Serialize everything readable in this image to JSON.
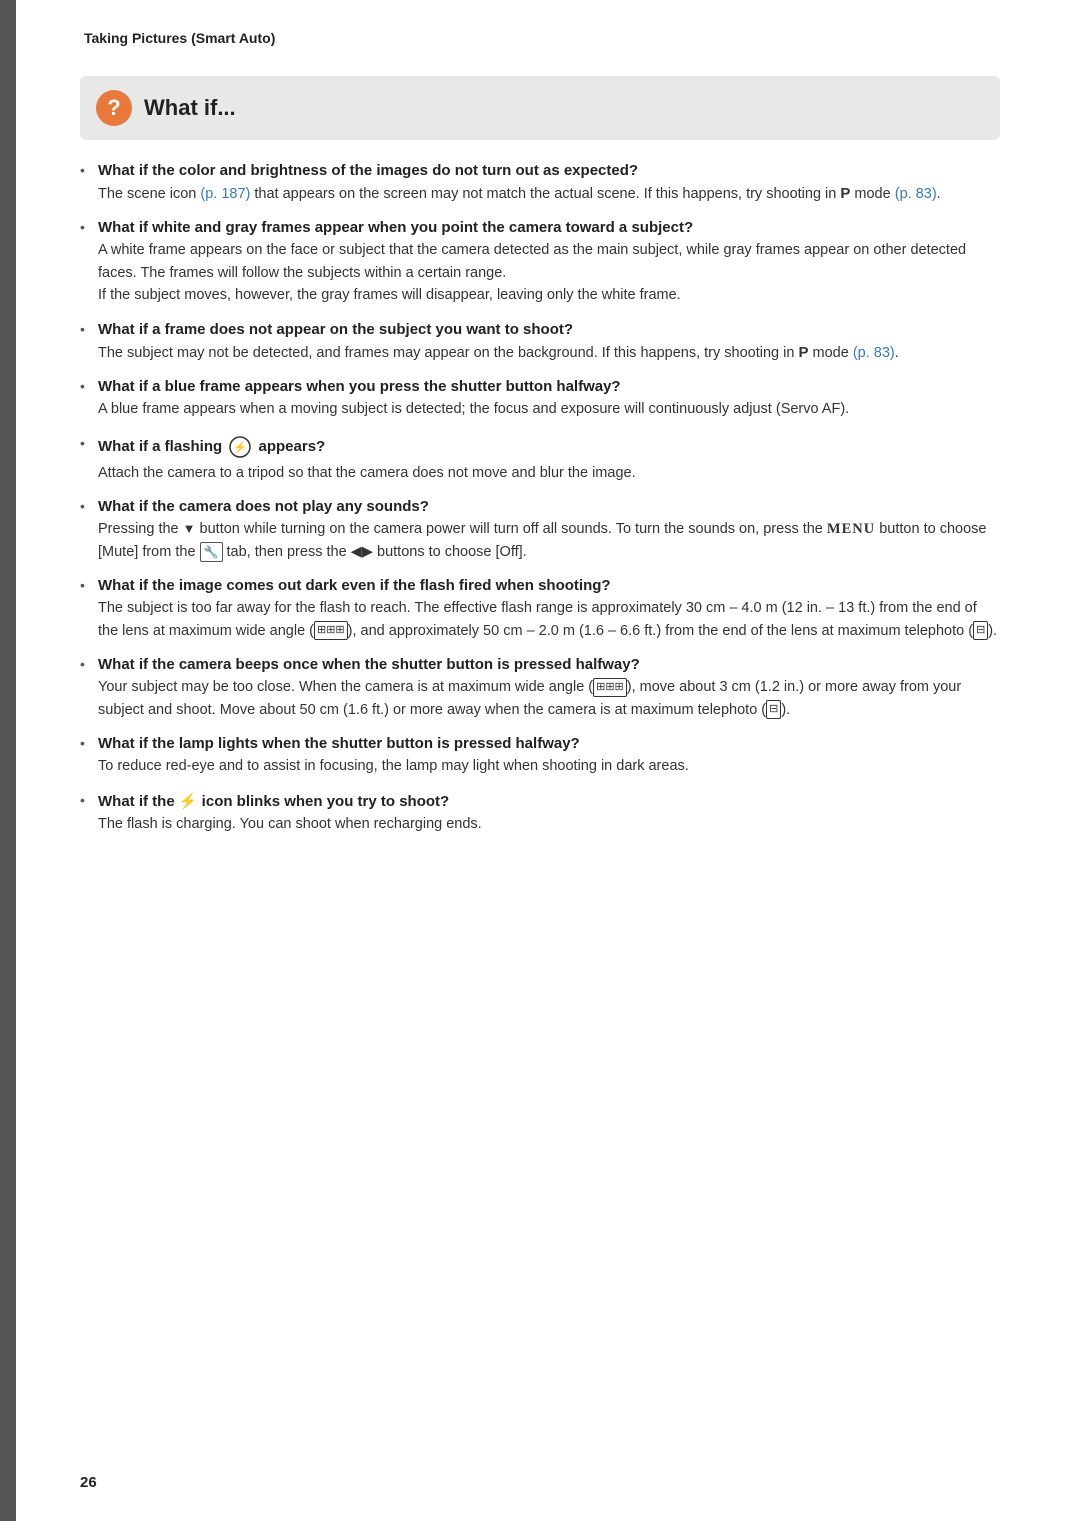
{
  "header": {
    "title": "Taking Pictures (Smart Auto)"
  },
  "what_if_box": {
    "icon_label": "?",
    "title": "What if..."
  },
  "items": [
    {
      "id": "item-color-brightness",
      "heading": "What if the color and brightness of the images do not turn out as expected?",
      "body_parts": [
        {
          "type": "text",
          "text": "The scene icon "
        },
        {
          "type": "link",
          "text": "(p. 187)"
        },
        {
          "type": "text",
          "text": " that appears on the screen may not match the actual scene. If this happens, try shooting in "
        },
        {
          "type": "bold",
          "text": "P"
        },
        {
          "type": "text",
          "text": " mode "
        },
        {
          "type": "link",
          "text": "(p. 83)"
        },
        {
          "type": "text",
          "text": "."
        }
      ]
    },
    {
      "id": "item-white-gray-frames",
      "heading": "What if white and gray frames appear when you point the camera toward a subject?",
      "body_parts": [
        {
          "type": "text",
          "text": "A white frame appears on the face or subject that the camera detected as the main subject, while gray frames appear on other detected faces. The frames will follow the subjects within a certain range.\nIf the subject moves, however, the gray frames will disappear, leaving only the white frame."
        }
      ]
    },
    {
      "id": "item-frame-not-appear",
      "heading": "What if a frame does not appear on the subject you want to shoot?",
      "body_parts": [
        {
          "type": "text",
          "text": "The subject may not be detected, and frames may appear on the background. If this happens, try shooting in "
        },
        {
          "type": "bold",
          "text": "P"
        },
        {
          "type": "text",
          "text": " mode "
        },
        {
          "type": "link",
          "text": "(p. 83)"
        },
        {
          "type": "text",
          "text": "."
        }
      ]
    },
    {
      "id": "item-blue-frame",
      "heading": "What if a blue frame appears when you press the shutter button halfway?",
      "body_parts": [
        {
          "type": "text",
          "text": "A blue frame appears when a moving subject is detected; the focus and exposure will continuously adjust (Servo AF)."
        }
      ]
    },
    {
      "id": "item-flashing",
      "heading": "What if a flashing",
      "heading_suffix": " appears?",
      "has_shake_icon": true,
      "body_parts": [
        {
          "type": "text",
          "text": "Attach the camera to a tripod so that the camera does not move and blur the image."
        }
      ]
    },
    {
      "id": "item-no-sounds",
      "heading": "What if the camera does not play any sounds?",
      "body_parts": [
        {
          "type": "text",
          "text": "Pressing the ▼ button while turning on the camera power will turn off all sounds. To turn the sounds on, press the MENU button to choose [Mute] from the 🔧 tab, then press the ◀▶ buttons to choose [Off]."
        }
      ]
    },
    {
      "id": "item-image-dark",
      "heading": "What if the image comes out dark even if the flash fired when shooting?",
      "body_parts": [
        {
          "type": "text",
          "text": "The subject is too far away for the flash to reach. The effective flash range is approximately 30 cm – 4.0 m (12 in. – 13 ft.) from the end of the lens at maximum wide angle (⊞), and approximately 50 cm – 2.0 m (1.6 – 6.6 ft.) from the end of the lens at maximum telephoto (⊟)."
        }
      ]
    },
    {
      "id": "item-beeps-halfway",
      "heading": "What if the camera beeps once when the shutter button is pressed halfway?",
      "body_parts": [
        {
          "type": "text",
          "text": "Your subject may be too close. When the camera is at maximum wide angle (⊞), move about 3 cm (1.2 in.) or more away from your subject and shoot. Move about 50 cm (1.6 ft.) or more away when the camera is at maximum telephoto (⊟)."
        }
      ]
    },
    {
      "id": "item-lamp-lights",
      "heading": "What if the lamp lights when the shutter button is pressed halfway?",
      "body_parts": [
        {
          "type": "text",
          "text": "To reduce red-eye and to assist in focusing, the lamp may light when shooting in dark areas."
        }
      ]
    },
    {
      "id": "item-flash-blinks",
      "heading": "What if the ⚡ icon blinks when you try to shoot?",
      "body_parts": [
        {
          "type": "text",
          "text": "The flash is charging. You can shoot when recharging ends."
        }
      ]
    }
  ],
  "page_number": "26"
}
